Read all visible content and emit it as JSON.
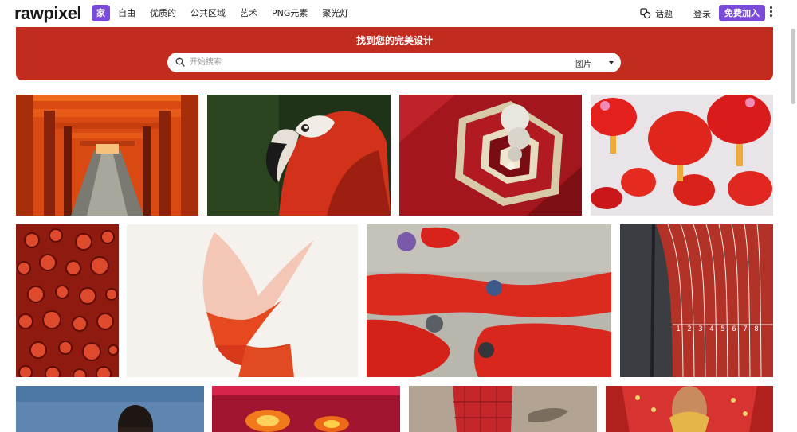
{
  "header": {
    "logo": "rawpixel",
    "nav": [
      "家",
      "自由",
      "优质的",
      "公共区域",
      "艺术",
      "PNG元素",
      "聚光灯"
    ],
    "topics_label": "话题",
    "login_label": "登录",
    "join_label": "免费加入"
  },
  "hero": {
    "title": "找到您的完美设计",
    "search_placeholder": "开始搜索",
    "search_value": "",
    "search_type": "图片"
  },
  "colors": {
    "accent": "#7a4bd9",
    "hero_red": "#c22c1f"
  },
  "gallery": {
    "tiles": [
      {
        "name": "image-torii-gates-tunnel",
        "subject": "torii-gates"
      },
      {
        "name": "image-scarlet-macaw",
        "subject": "macaw"
      },
      {
        "name": "image-hexagon-stairwell-chandelier",
        "subject": "stairwell"
      },
      {
        "name": "image-red-lanterns",
        "subject": "lanterns"
      },
      {
        "name": "image-octopus-suckers",
        "subject": "octopus"
      },
      {
        "name": "image-fish-tail-fin",
        "subject": "fin"
      },
      {
        "name": "image-red-fabric-dyeing",
        "subject": "fabric"
      },
      {
        "name": "image-running-track-lanes",
        "subject": "track"
      },
      {
        "name": "image-portrait-sky",
        "subject": "portrait"
      },
      {
        "name": "image-red-glowing-lights",
        "subject": "lights"
      },
      {
        "name": "image-red-robe-sandals",
        "subject": "robe"
      },
      {
        "name": "image-red-bridal-dress",
        "subject": "bride"
      }
    ],
    "track_lane_numbers": [
      "1",
      "2",
      "3",
      "4",
      "5",
      "6",
      "7",
      "8"
    ]
  }
}
